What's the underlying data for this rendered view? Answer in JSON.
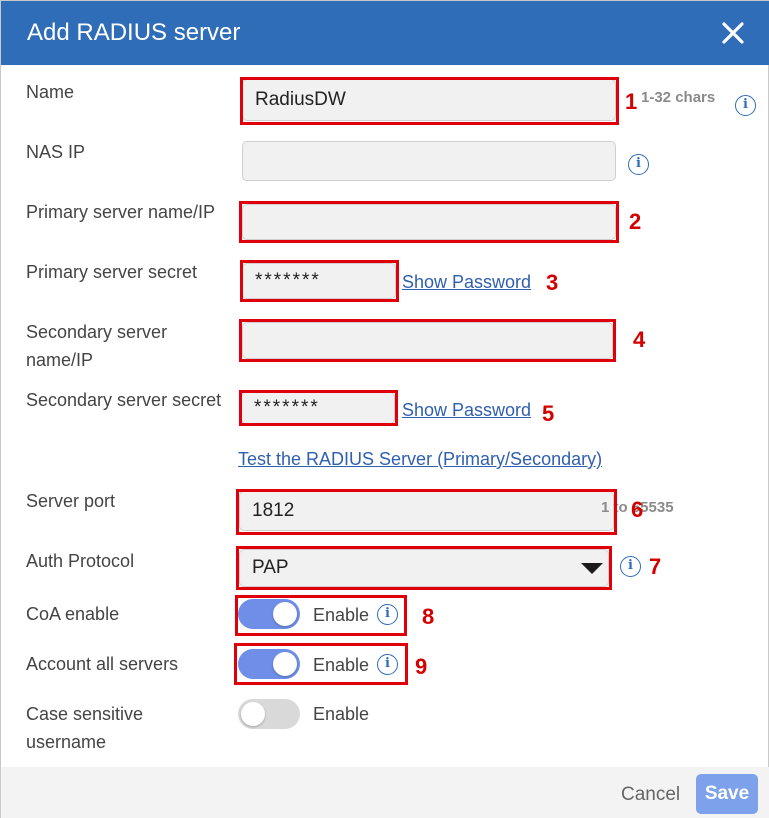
{
  "dialog": {
    "title": "Add RADIUS server",
    "close_icon": "close-icon"
  },
  "fields": {
    "name": {
      "label": "Name",
      "value": "RadiusDW",
      "hint": "1-32 chars"
    },
    "nas_ip": {
      "label": "NAS IP",
      "value": ""
    },
    "primary_server": {
      "label": "Primary server name/IP",
      "value": ""
    },
    "primary_secret": {
      "label": "Primary server secret",
      "value": "*******",
      "show_password": "Show Password"
    },
    "secondary_server": {
      "label_line1": "Secondary server",
      "label_line2": "name/IP",
      "value": ""
    },
    "secondary_secret": {
      "label": "Secondary server secret",
      "value": "*******",
      "show_password": "Show Password"
    },
    "test_link": "Test the RADIUS Server (Primary/Secondary)",
    "server_port": {
      "label": "Server port",
      "value": "1812",
      "hint": "1 to 65535"
    },
    "auth_protocol": {
      "label": "Auth Protocol",
      "selected": "PAP"
    },
    "coa_enable": {
      "label": "CoA enable",
      "toggle_label": "Enable",
      "enabled": true
    },
    "account_all": {
      "label": "Account all servers",
      "toggle_label": "Enable",
      "enabled": true
    },
    "case_sensitive": {
      "label_line1": "Case sensitive",
      "label_line2": "username",
      "toggle_label": "Enable",
      "enabled": false
    }
  },
  "annotations": {
    "n1": "1",
    "n2": "2",
    "n3": "3",
    "n4": "4",
    "n5": "5",
    "n6": "6",
    "n7": "7",
    "n8": "8",
    "n9": "9",
    "color": "#e0000a"
  },
  "footer": {
    "cancel": "Cancel",
    "save": "Save"
  },
  "colors": {
    "header": "#2f6db8",
    "toggle_on": "#6f8ee8",
    "save_button": "#7da1ea",
    "link": "#2f5fb0"
  }
}
